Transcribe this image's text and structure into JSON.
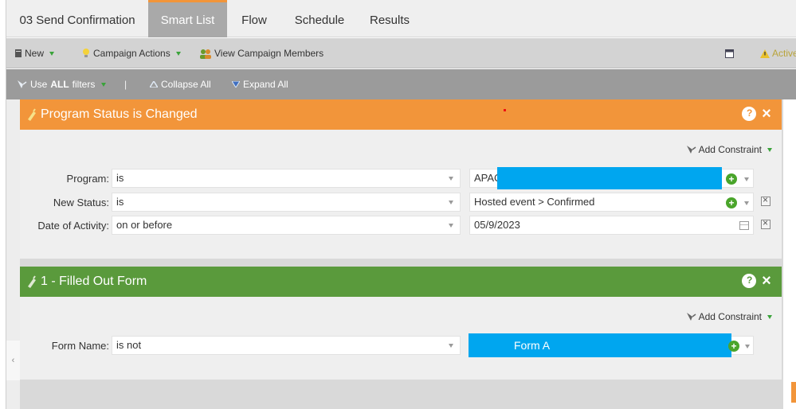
{
  "tabs": [
    {
      "label": "03 Send Confirmation"
    },
    {
      "label": "Smart List"
    },
    {
      "label": "Flow"
    },
    {
      "label": "Schedule"
    },
    {
      "label": "Results"
    }
  ],
  "toolbar": {
    "new_label": "New",
    "campaign_actions_label": "Campaign Actions",
    "view_members_label": "View Campaign Members",
    "active_label": "Active"
  },
  "filterbar": {
    "use_prefix": "Use",
    "use_all": "ALL",
    "use_suffix": "filters",
    "separator": "|",
    "collapse_all": "Collapse All",
    "expand_all": "Expand All"
  },
  "filters": [
    {
      "title": "Program Status is Changed",
      "color": "#f2953a",
      "add_constraint": "Add Constraint",
      "rows": [
        {
          "label": "Program:",
          "operator": "is",
          "value": "APAC"
        },
        {
          "label": "New Status:",
          "operator": "is",
          "value": "Hosted event > Confirmed"
        },
        {
          "label": "Date of Activity:",
          "operator": "on or before",
          "value": "05/9/2023"
        }
      ]
    },
    {
      "title": "1 - Filled Out Form",
      "color": "#5a9a3c",
      "add_constraint": "Add Constraint",
      "rows": [
        {
          "label": "Form Name:",
          "operator": "is not",
          "value": "Form A"
        }
      ]
    }
  ],
  "icons": {
    "new": "notepad-icon",
    "campaign_actions": "lightbulb-icon",
    "view_members": "people-icon",
    "window": "window-icon",
    "warning": "warning-icon",
    "filter": "filter-funnel-icon",
    "collapse": "triangle-up-icon",
    "expand": "triangle-down-icon"
  }
}
